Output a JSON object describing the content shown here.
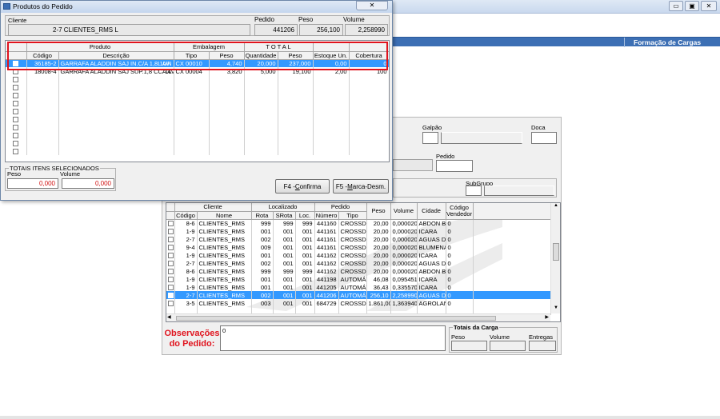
{
  "main_window": {
    "header_title": "Formação de Cargas",
    "fields": {
      "galpao_label": "Galpão",
      "doca_label": "Doca",
      "pedido_label": "Pedido",
      "subgrupo_label": "SubGrupo"
    },
    "orders_table": {
      "group_headers": {
        "cliente": "Cliente",
        "localizado": "Localizado",
        "pedido": "Pedido"
      },
      "columns": [
        "Código",
        "Nome",
        "Rota",
        "SRota",
        "Loc.",
        "Número",
        "Tipo",
        "Peso",
        "Volume",
        "Cidade",
        "Código Vendedor"
      ],
      "rows": [
        {
          "codigo": "8-6",
          "nome": "CLIENTES_RMS",
          "letra": "L",
          "rota": "999",
          "srota": "999",
          "loc": "999",
          "numero": "441160",
          "tipo": "CROSSDO(",
          "peso": "20,00",
          "volume": "0,000020",
          "cidade": "ABDON BAT",
          "vendedor": "0"
        },
        {
          "codigo": "1-9",
          "nome": "CLIENTES_RMS",
          "letra": "L",
          "rota": "001",
          "srota": "001",
          "loc": "001",
          "numero": "441161",
          "tipo": "CROSSDO(",
          "peso": "20,00",
          "volume": "0,000020",
          "cidade": "ICARA",
          "vendedor": "0"
        },
        {
          "codigo": "2-7",
          "nome": "CLIENTES_RMS",
          "letra": "L",
          "rota": "002",
          "srota": "001",
          "loc": "001",
          "numero": "441161",
          "tipo": "CROSSDO(",
          "peso": "20,00",
          "volume": "0,000020",
          "cidade": "AGUAS DE (",
          "vendedor": "0"
        },
        {
          "codigo": "9-4",
          "nome": "CLIENTES_RMS",
          "letra": "L",
          "rota": "009",
          "srota": "001",
          "loc": "001",
          "numero": "441161",
          "tipo": "CROSSDO(",
          "peso": "20,00",
          "volume": "0,000020",
          "cidade": "BLUMENAU",
          "vendedor": "0"
        },
        {
          "codigo": "1-9",
          "nome": "CLIENTES_RMS",
          "letra": "L",
          "rota": "001",
          "srota": "001",
          "loc": "001",
          "numero": "441162",
          "tipo": "CROSSDO(",
          "peso": "20,00",
          "volume": "0,000020",
          "cidade": "ICARA",
          "vendedor": "0"
        },
        {
          "codigo": "2-7",
          "nome": "CLIENTES_RMS",
          "letra": "L",
          "rota": "002",
          "srota": "001",
          "loc": "001",
          "numero": "441162",
          "tipo": "CROSSDO(",
          "peso": "20,00",
          "volume": "0,000020",
          "cidade": "AGUAS DE (",
          "vendedor": "0"
        },
        {
          "codigo": "8-6",
          "nome": "CLIENTES_RMS",
          "letra": "L",
          "rota": "999",
          "srota": "999",
          "loc": "999",
          "numero": "441162",
          "tipo": "CROSSDO(",
          "peso": "20,00",
          "volume": "0,000020",
          "cidade": "ABDON BAT",
          "vendedor": "0"
        },
        {
          "codigo": "1-9",
          "nome": "CLIENTES_RMS",
          "letra": "L",
          "rota": "001",
          "srota": "001",
          "loc": "001",
          "numero": "441198",
          "tipo": "AUTOMÁTI",
          "peso": "46,08",
          "volume": "0,095451",
          "cidade": "ICARA",
          "vendedor": "0"
        },
        {
          "codigo": "1-9",
          "nome": "CLIENTES_RMS",
          "letra": "L",
          "rota": "001",
          "srota": "001",
          "loc": "001",
          "numero": "441205",
          "tipo": "AUTOMÁTI",
          "peso": "36,43",
          "volume": "0,335570",
          "cidade": "ICARA",
          "vendedor": "0"
        },
        {
          "codigo": "2-7",
          "nome": "CLIENTES_RMS",
          "letra": "L",
          "rota": "002",
          "srota": "001",
          "loc": "001",
          "numero": "441206",
          "tipo": "AUTOMÁTI",
          "peso": "256,10",
          "volume": "2,258990",
          "cidade": "AGUAS DE (",
          "vendedor": "0"
        },
        {
          "codigo": "3-5",
          "nome": "CLIENTES_RMS",
          "letra": "L",
          "rota": "003",
          "srota": "001",
          "loc": "001",
          "numero": "684729",
          "tipo": "CROSSDO(",
          "peso": "1.861,00",
          "volume": "1,363940",
          "cidade": "AGROLANDI",
          "vendedor": "0"
        }
      ],
      "selected_index": 9
    },
    "observacoes_label": "Observações do Pedido:",
    "observacoes_value": "0",
    "totais_carga": {
      "title": "Totais da Carga",
      "peso": "Peso",
      "volume": "Volume",
      "entregas": "Entregas"
    }
  },
  "dialog": {
    "title": "Produtos do Pedido",
    "header": {
      "cliente_label": "Cliente",
      "cliente_value": "2-7  CLIENTES_RMS    L",
      "pedido_label": "Pedido",
      "pedido_value": "441206",
      "peso_label": "Peso",
      "peso_value": "256,100",
      "volume_label": "Volume",
      "volume_value": "2,258990"
    },
    "products_table": {
      "group_headers": {
        "produto": "Produto",
        "embalagem": "Embalagem",
        "total": "T O T A L"
      },
      "columns": [
        "Código",
        "Descrição",
        "Tipo",
        "Peso",
        "Quantidade",
        "Peso",
        "Estoque Un.",
        "Cobertura"
      ],
      "rows": [
        {
          "codigo": "36185-2",
          "descricao": "GARRAFA ALADDIN SAJ IN.C/A 1,8L AV",
          "un": "1UN",
          "tipo": "CX 00010",
          "peso": "4,740",
          "quantidade": "20,000",
          "peso_total": "237,000",
          "estoque": "0,00",
          "cobertura": "0"
        },
        {
          "codigo": "18008-4",
          "descricao": "GARRAFA ALADDIN SAJ SUP.1,8 CCA AV",
          "un": "1L",
          "tipo": "CX 00004",
          "peso": "3,820",
          "quantidade": "5,000",
          "peso_total": "19,100",
          "estoque": "2,00",
          "cobertura": "100"
        }
      ]
    },
    "totais_selecionados": {
      "title": "TOTAIS ITENS SELECIONADOS",
      "peso_label": "Peso",
      "volume_label": "Volume",
      "peso_value": "0,000",
      "volume_value": "0,000"
    },
    "buttons": {
      "confirma_prefix": "F4 - ",
      "confirma_key": "C",
      "confirma_rest": "onfirma",
      "marca_prefix": "F5 - ",
      "marca_key": "M",
      "marca_rest": "arca-Desm."
    }
  },
  "colors": {
    "selection": "#3399ff",
    "header_bar": "#3c6fb4",
    "highlight_border": "#e0141e",
    "alert_text": "#e0141e",
    "total_value": "#d01010"
  }
}
